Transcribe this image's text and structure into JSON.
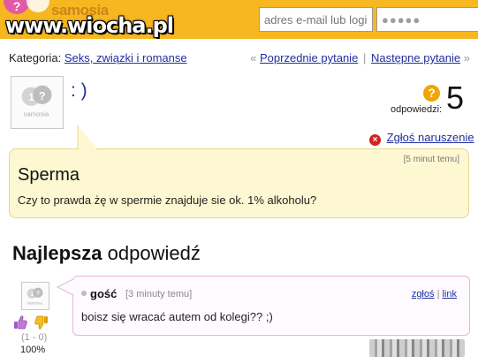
{
  "header": {
    "watermark": "www.wiocha.pl",
    "logo_text": "samosia",
    "login": {
      "email_placeholder": "adres e-mail lub login",
      "password_value": "●●●●●"
    }
  },
  "category": {
    "label": "Kategoria:",
    "value": "Seks, związki i romanse"
  },
  "navigation": {
    "prev_marker": "«",
    "prev_label": "Poprzednie pytanie",
    "separator": "|",
    "next_label": "Następne pytanie",
    "next_marker": "»"
  },
  "question": {
    "author": ": )",
    "answers_label": "odpowiedzi:",
    "answers_count": "5",
    "report_label": "Zgłoś naruszenie",
    "time": "[5 minut temu]",
    "title": "Sperma",
    "body": "Czy to prawda żę w spermie znajduje sie ok. 1% alkoholu?"
  },
  "best_answer": {
    "heading_bold": "Najlepsza",
    "heading_rest": "odpowiedź",
    "author": "gość",
    "time": "[3 minuty temu]",
    "report_label": "zgłoś",
    "separator": "|",
    "link_label": "link",
    "body": "boisz się wracać autem od kolegi?? ;)",
    "votes": "(1 - 0)",
    "percent": "100%"
  },
  "colors": {
    "topbar": "#f6b720",
    "link": "#1f2fa0",
    "question_bg": "#fdf8d2",
    "answer_border": "#e5b6d8"
  },
  "icons": [
    "question-bubble-icon",
    "report-x-icon",
    "thumbs-up-icon",
    "thumbs-down-icon",
    "answers-question-icon"
  ]
}
